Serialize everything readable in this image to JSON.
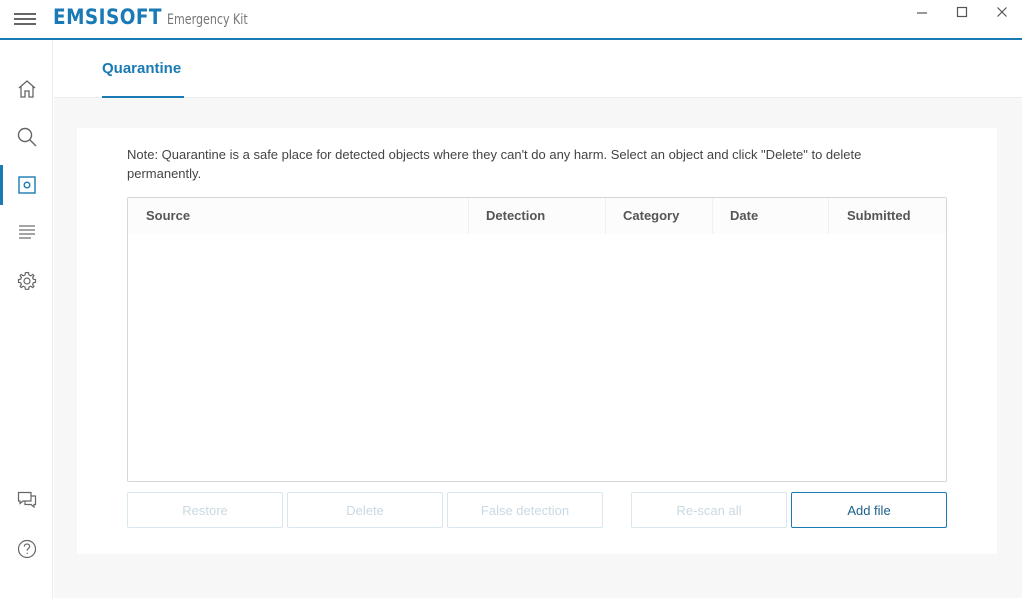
{
  "app": {
    "brand": "EMSISOFT",
    "product": "Emergency Kit"
  },
  "window_controls": {
    "minimize_icon": "minimize-icon",
    "maximize_icon": "maximize-icon",
    "close_icon": "close-icon"
  },
  "sidebar": {
    "items": [
      {
        "name": "home",
        "icon": "home-icon",
        "active": false
      },
      {
        "name": "scan",
        "icon": "search-icon",
        "active": false
      },
      {
        "name": "quarantine",
        "icon": "quarantine-icon",
        "active": true
      },
      {
        "name": "logs",
        "icon": "logs-icon",
        "active": false
      },
      {
        "name": "settings",
        "icon": "gear-icon",
        "active": false
      },
      {
        "name": "feedback",
        "icon": "chat-icon",
        "active": false
      },
      {
        "name": "help",
        "icon": "help-icon",
        "active": false
      }
    ]
  },
  "tabs": {
    "active_label": "Quarantine"
  },
  "quarantine": {
    "note": "Note: Quarantine is a safe place for detected objects where they can't do any harm. Select an object and click \"Delete\" to delete permanently.",
    "columns": [
      "Source",
      "Detection",
      "Category",
      "Date",
      "Submitted"
    ],
    "rows": [],
    "buttons": {
      "restore": "Restore",
      "delete": "Delete",
      "false_detection": "False detection",
      "rescan_all": "Re-scan all",
      "add_file": "Add file"
    }
  },
  "colors": {
    "accent": "#1a7ab5",
    "disabled_text": "#c9d9e3"
  }
}
